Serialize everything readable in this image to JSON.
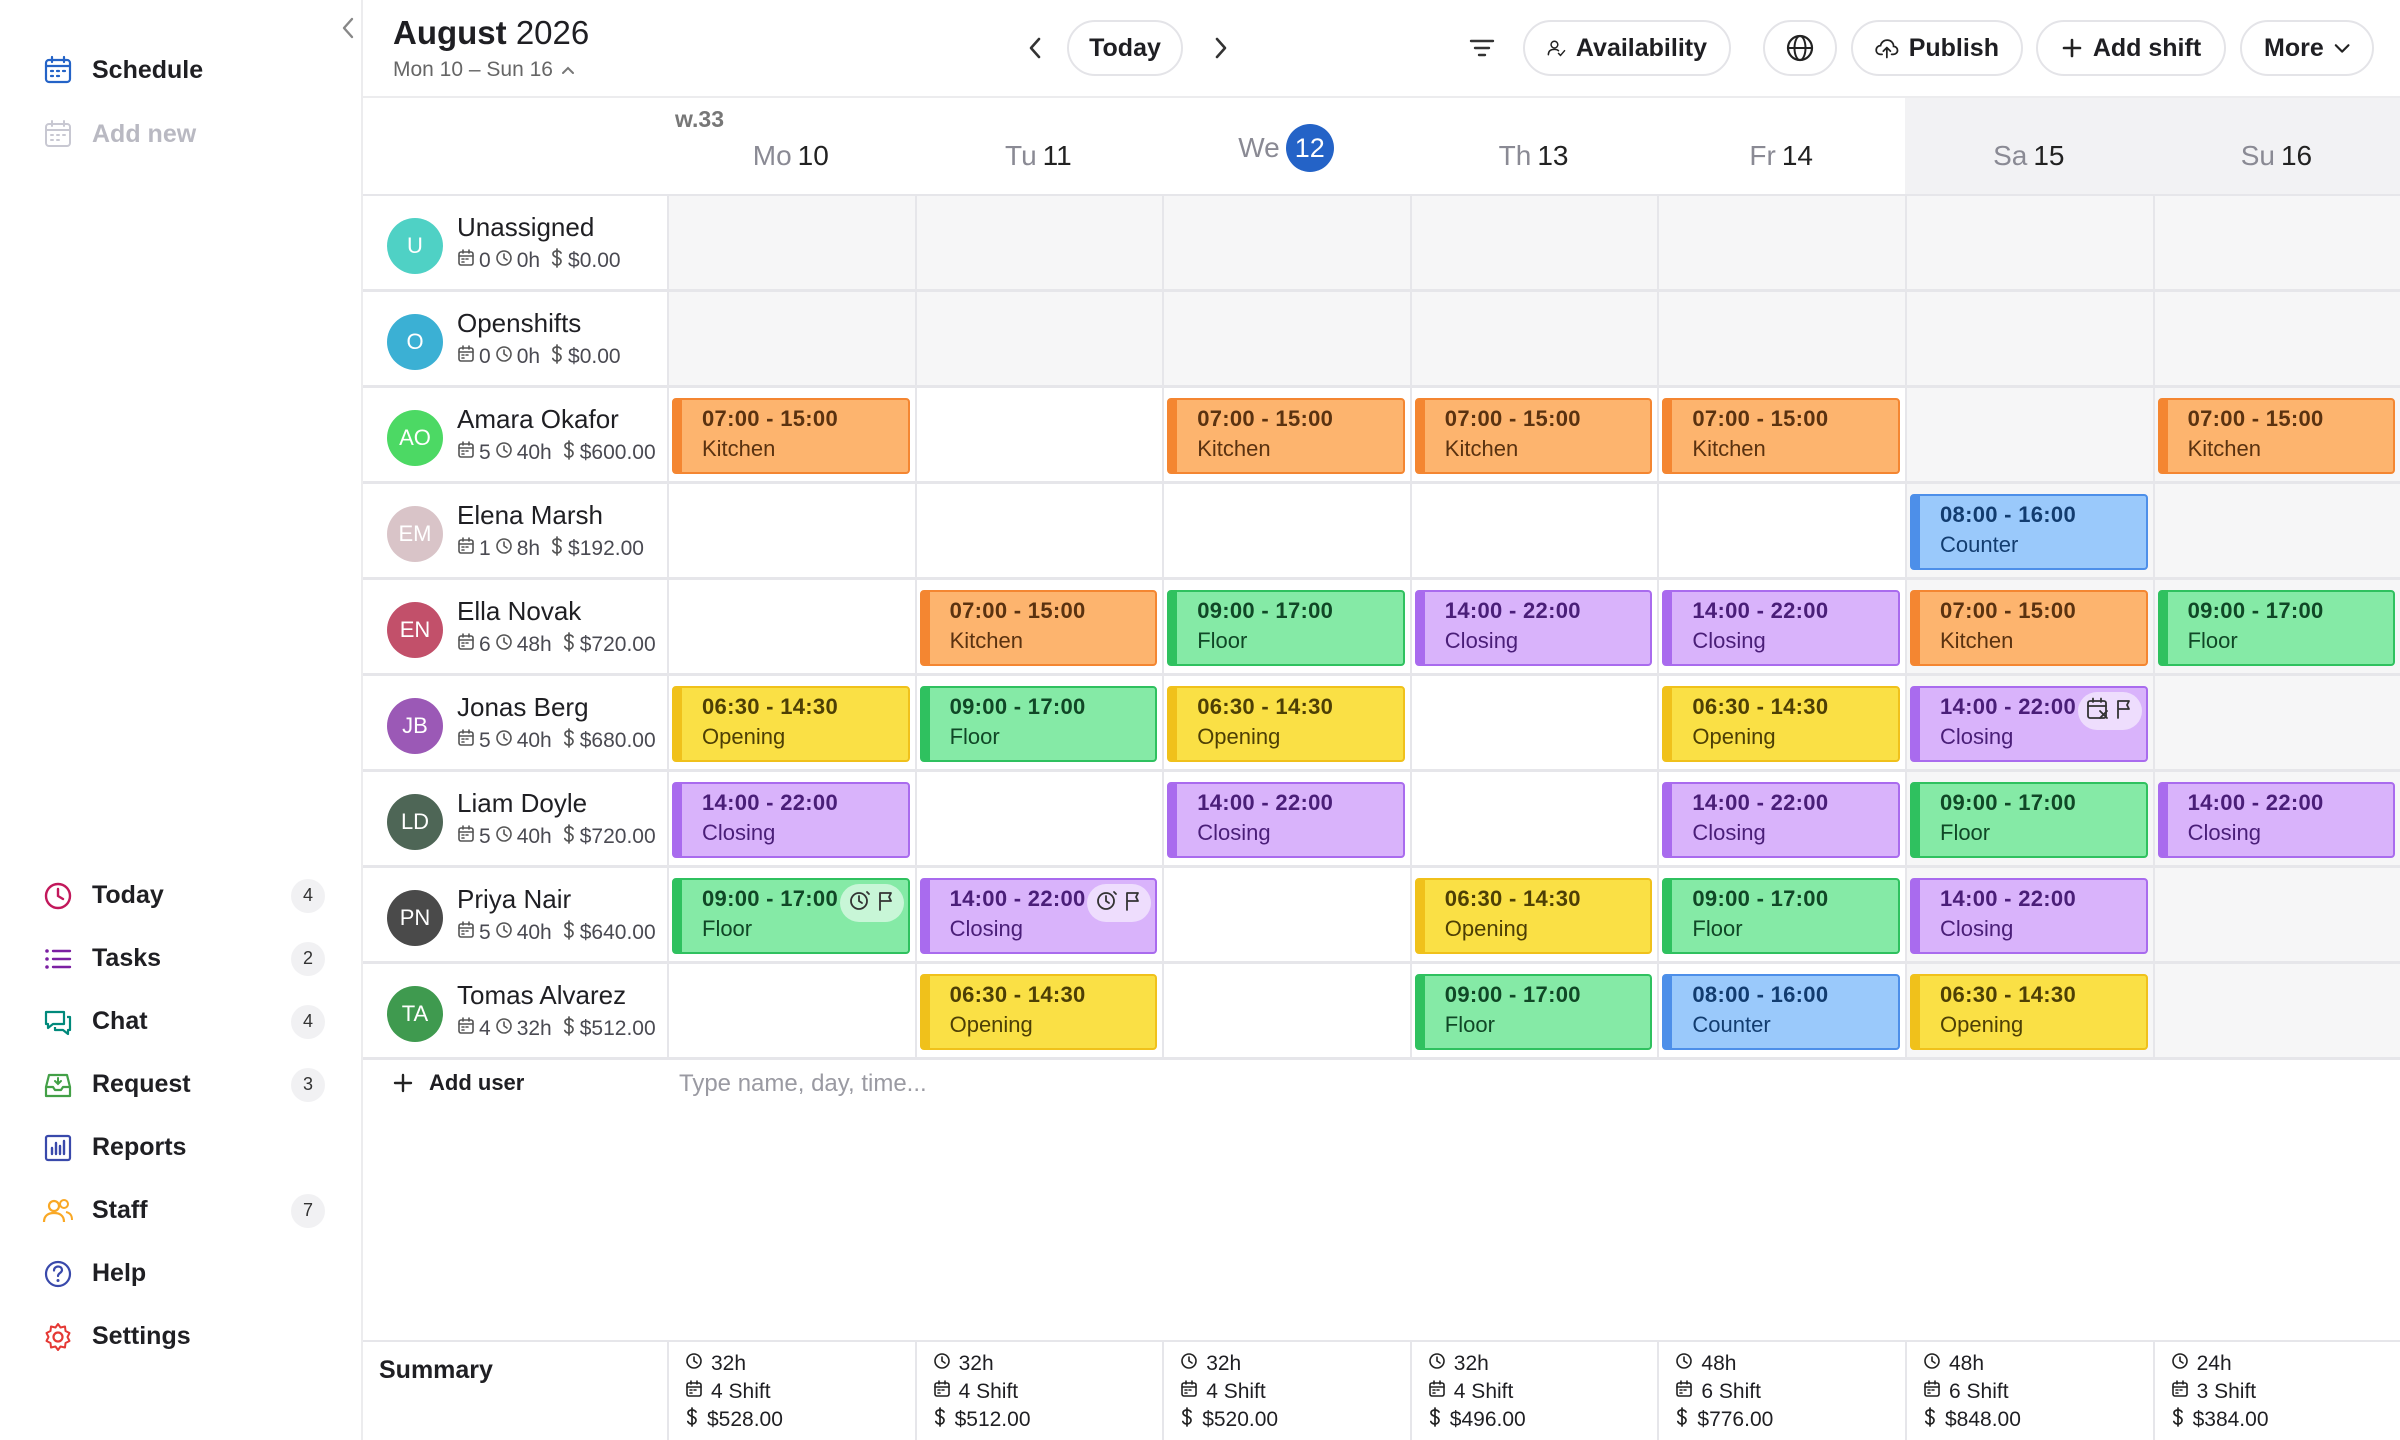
{
  "sidebar": {
    "top": [
      {
        "label": "Schedule",
        "icon": "calendar-icon",
        "disabled": false
      },
      {
        "label": "Add new",
        "icon": "calendar-plus-icon",
        "disabled": true
      }
    ],
    "bottom": [
      {
        "label": "Today",
        "icon": "clock-icon",
        "badge": "4",
        "color": "#c2185b"
      },
      {
        "label": "Tasks",
        "icon": "list-icon",
        "badge": "2",
        "color": "#7b1fa2"
      },
      {
        "label": "Chat",
        "icon": "chat-icon",
        "badge": "4",
        "color": "#00897b"
      },
      {
        "label": "Request",
        "icon": "inbox-icon",
        "badge": "3",
        "color": "#43a047"
      },
      {
        "label": "Reports",
        "icon": "bar-chart-icon",
        "badge": "",
        "color": "#3949ab"
      },
      {
        "label": "Staff",
        "icon": "users-icon",
        "badge": "7",
        "color": "#f9a825"
      },
      {
        "label": "Help",
        "icon": "help-circle-icon",
        "badge": "",
        "color": "#3949ab"
      },
      {
        "label": "Settings",
        "icon": "gear-icon",
        "badge": "",
        "color": "#e53935"
      }
    ]
  },
  "header": {
    "month": "August",
    "year": "2026",
    "range": "Mon 10 – Sun 16",
    "today_label": "Today",
    "availability_label": "Availability",
    "publish_label": "Publish",
    "add_shift_label": "Add shift",
    "more_label": "More"
  },
  "week": {
    "label": "w.33",
    "days": [
      {
        "dow": "Mo",
        "num": "10",
        "today": false,
        "weekend": false
      },
      {
        "dow": "Tu",
        "num": "11",
        "today": false,
        "weekend": false
      },
      {
        "dow": "We",
        "num": "12",
        "today": true,
        "weekend": false
      },
      {
        "dow": "Th",
        "num": "13",
        "today": false,
        "weekend": false
      },
      {
        "dow": "Fr",
        "num": "14",
        "today": false,
        "weekend": false
      },
      {
        "dow": "Sa",
        "num": "15",
        "today": false,
        "weekend": true
      },
      {
        "dow": "Su",
        "num": "16",
        "today": false,
        "weekend": true
      }
    ]
  },
  "rows": [
    {
      "name": "Unassigned",
      "initials": "U",
      "avatar_color": "#4fd1c5",
      "shifts_count": "0",
      "hours": "0h",
      "cost": "$0.00",
      "grey": true,
      "shifts": []
    },
    {
      "name": "Openshifts",
      "initials": "O",
      "avatar_color": "#3bb0d4",
      "shifts_count": "0",
      "hours": "0h",
      "cost": "$0.00",
      "grey": true,
      "shifts": []
    },
    {
      "name": "Amara Okafor",
      "initials": "AO",
      "avatar_color": "#4cd964",
      "shifts_count": "5",
      "hours": "40h",
      "cost": "$600.00",
      "shifts": [
        {
          "day": 0,
          "time": "07:00 - 15:00",
          "role": "Kitchen",
          "color": "orange"
        },
        {
          "day": 2,
          "time": "07:00 - 15:00",
          "role": "Kitchen",
          "color": "orange"
        },
        {
          "day": 3,
          "time": "07:00 - 15:00",
          "role": "Kitchen",
          "color": "orange"
        },
        {
          "day": 4,
          "time": "07:00 - 15:00",
          "role": "Kitchen",
          "color": "orange"
        },
        {
          "day": 6,
          "time": "07:00 - 15:00",
          "role": "Kitchen",
          "color": "orange"
        }
      ]
    },
    {
      "name": "Elena Marsh",
      "initials": "EM",
      "avatar_color": "#d9c4c8",
      "shifts_count": "1",
      "hours": "8h",
      "cost": "$192.00",
      "shifts": [
        {
          "day": 5,
          "time": "08:00 - 16:00",
          "role": "Counter",
          "color": "blue"
        }
      ]
    },
    {
      "name": "Ella Novak",
      "initials": "EN",
      "avatar_color": "#c2506a",
      "shifts_count": "6",
      "hours": "48h",
      "cost": "$720.00",
      "shifts": [
        {
          "day": 1,
          "time": "07:00 - 15:00",
          "role": "Kitchen",
          "color": "orange"
        },
        {
          "day": 2,
          "time": "09:00 - 17:00",
          "role": "Floor",
          "color": "green"
        },
        {
          "day": 3,
          "time": "14:00 - 22:00",
          "role": "Closing",
          "color": "purple"
        },
        {
          "day": 4,
          "time": "14:00 - 22:00",
          "role": "Closing",
          "color": "purple"
        },
        {
          "day": 5,
          "time": "07:00 - 15:00",
          "role": "Kitchen",
          "color": "orange"
        },
        {
          "day": 6,
          "time": "09:00 - 17:00",
          "role": "Floor",
          "color": "green"
        }
      ]
    },
    {
      "name": "Jonas Berg",
      "initials": "JB",
      "avatar_color": "#9b59b6",
      "shifts_count": "5",
      "hours": "40h",
      "cost": "$680.00",
      "shifts": [
        {
          "day": 0,
          "time": "06:30 - 14:30",
          "role": "Opening",
          "color": "yellow"
        },
        {
          "day": 1,
          "time": "09:00 - 17:00",
          "role": "Floor",
          "color": "green"
        },
        {
          "day": 2,
          "time": "06:30 - 14:30",
          "role": "Opening",
          "color": "yellow"
        },
        {
          "day": 4,
          "time": "06:30 - 14:30",
          "role": "Opening",
          "color": "yellow"
        },
        {
          "day": 5,
          "time": "14:00 - 22:00",
          "role": "Closing",
          "color": "purple",
          "flags": [
            "calendar-x-icon",
            "flag-icon"
          ]
        }
      ]
    },
    {
      "name": "Liam Doyle",
      "initials": "LD",
      "avatar_color": "#4e6656",
      "shifts_count": "5",
      "hours": "40h",
      "cost": "$720.00",
      "shifts": [
        {
          "day": 0,
          "time": "14:00 - 22:00",
          "role": "Closing",
          "color": "purple"
        },
        {
          "day": 2,
          "time": "14:00 - 22:00",
          "role": "Closing",
          "color": "purple"
        },
        {
          "day": 4,
          "time": "14:00 - 22:00",
          "role": "Closing",
          "color": "purple"
        },
        {
          "day": 5,
          "time": "09:00 - 17:00",
          "role": "Floor",
          "color": "green"
        },
        {
          "day": 6,
          "time": "14:00 - 22:00",
          "role": "Closing",
          "color": "purple"
        }
      ]
    },
    {
      "name": "Priya Nair",
      "initials": "PN",
      "avatar_color": "#4a4a4a",
      "shifts_count": "5",
      "hours": "40h",
      "cost": "$640.00",
      "shifts": [
        {
          "day": 0,
          "time": "09:00 - 17:00",
          "role": "Floor",
          "color": "green",
          "flags": [
            "clock-alert-icon",
            "flag-icon"
          ]
        },
        {
          "day": 1,
          "time": "14:00 - 22:00",
          "role": "Closing",
          "color": "purple",
          "flags": [
            "clock-alert-icon",
            "flag-icon"
          ]
        },
        {
          "day": 3,
          "time": "06:30 - 14:30",
          "role": "Opening",
          "color": "yellow"
        },
        {
          "day": 4,
          "time": "09:00 - 17:00",
          "role": "Floor",
          "color": "green"
        },
        {
          "day": 5,
          "time": "14:00 - 22:00",
          "role": "Closing",
          "color": "purple"
        }
      ]
    },
    {
      "name": "Tomas Alvarez",
      "initials": "TA",
      "avatar_color": "#3f9a4f",
      "shifts_count": "4",
      "hours": "32h",
      "cost": "$512.00",
      "shifts": [
        {
          "day": 1,
          "time": "06:30 - 14:30",
          "role": "Opening",
          "color": "yellow"
        },
        {
          "day": 3,
          "time": "09:00 - 17:00",
          "role": "Floor",
          "color": "green"
        },
        {
          "day": 4,
          "time": "08:00 - 16:00",
          "role": "Counter",
          "color": "blue"
        },
        {
          "day": 5,
          "time": "06:30 - 14:30",
          "role": "Opening",
          "color": "yellow"
        }
      ]
    }
  ],
  "add_user_label": "Add user",
  "quick_add_placeholder": "Type name, day, time...",
  "summary": {
    "title": "Summary",
    "days": [
      {
        "hours": "32h",
        "shifts": "4 Shift",
        "cost": "$528.00"
      },
      {
        "hours": "32h",
        "shifts": "4 Shift",
        "cost": "$512.00"
      },
      {
        "hours": "32h",
        "shifts": "4 Shift",
        "cost": "$520.00"
      },
      {
        "hours": "32h",
        "shifts": "4 Shift",
        "cost": "$496.00"
      },
      {
        "hours": "48h",
        "shifts": "6 Shift",
        "cost": "$776.00"
      },
      {
        "hours": "48h",
        "shifts": "6 Shift",
        "cost": "$848.00"
      },
      {
        "hours": "24h",
        "shifts": "3 Shift",
        "cost": "$384.00"
      }
    ]
  }
}
